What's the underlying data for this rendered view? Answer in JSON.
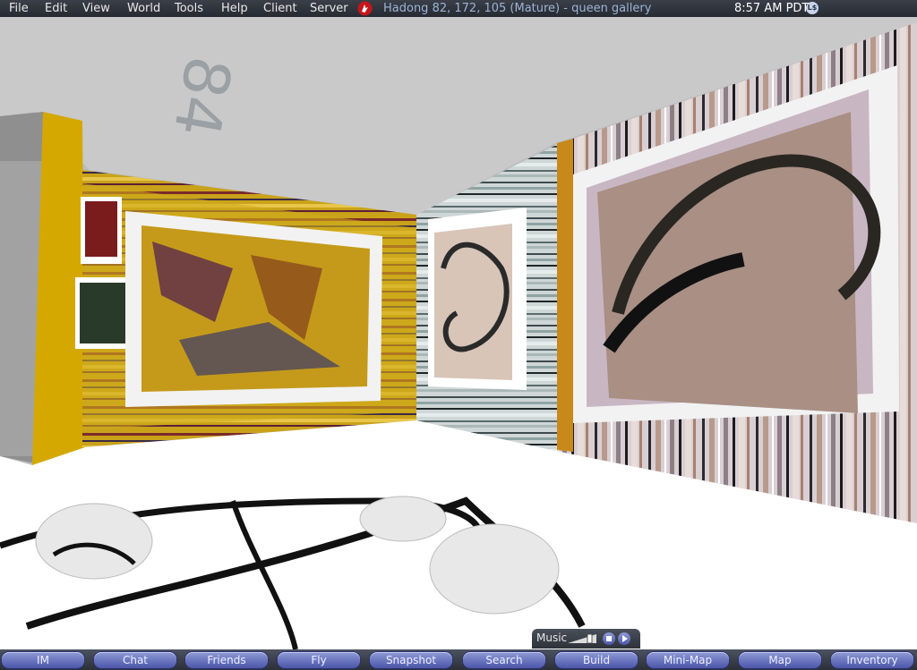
{
  "menubar": {
    "items": [
      "File",
      "Edit",
      "View",
      "World",
      "Tools",
      "Help",
      "Client",
      "Server"
    ],
    "location": "Hadong 82, 172, 105 (Mature) - queen gallery",
    "time": "8:57 AM PDT",
    "currency_icon": "L$"
  },
  "scene": {
    "ceiling_number": "84"
  },
  "music": {
    "label": "Music",
    "volume": 0.8
  },
  "toolbar": {
    "buttons": [
      "IM",
      "Chat",
      "Friends",
      "Fly",
      "Snapshot",
      "Search",
      "Build",
      "Mini-Map",
      "Map",
      "Inventory"
    ]
  },
  "icons": [
    "second-life-logo-icon",
    "linden-dollar-icon",
    "volume-slider-icon",
    "stop-icon",
    "play-icon"
  ]
}
